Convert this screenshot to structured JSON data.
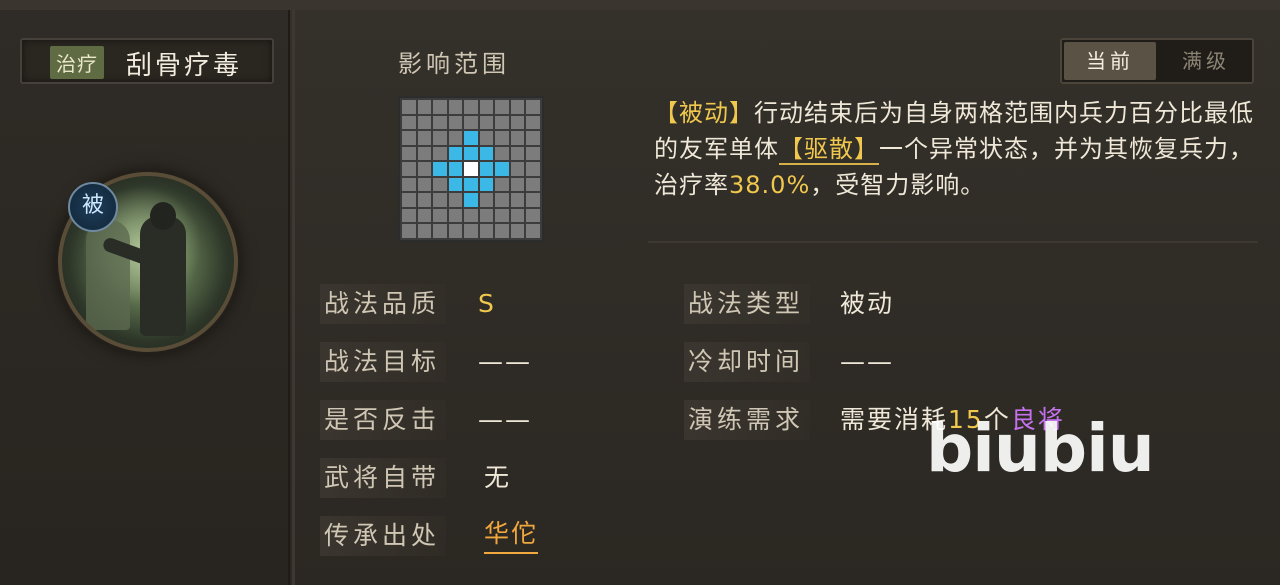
{
  "skill": {
    "type_tag": "治疗",
    "name": "刮骨疗毒",
    "passive_badge": "被"
  },
  "tabs": {
    "current": "当前",
    "max_level": "满级"
  },
  "range": {
    "label": "影响范围",
    "rows": 9,
    "cols": 9,
    "hit_cells": [
      [
        2,
        4
      ],
      [
        3,
        3
      ],
      [
        3,
        4
      ],
      [
        3,
        5
      ],
      [
        4,
        2
      ],
      [
        4,
        3
      ],
      [
        4,
        5
      ],
      [
        4,
        6
      ],
      [
        5,
        3
      ],
      [
        5,
        4
      ],
      [
        5,
        5
      ],
      [
        6,
        4
      ]
    ],
    "center_cell": [
      4,
      4
    ]
  },
  "description": {
    "tag": "【被动】",
    "text1": "行动结束后为自身两格范围内兵力百分比最低的友军单体",
    "keyword": "【驱散】",
    "text2": "一个异常状态，并为其恢复兵力，治疗率",
    "rate": "38.0%",
    "text3": "，受智力影响。"
  },
  "attributes": {
    "quality_label": "战法品质",
    "quality_value": "S",
    "type_label": "战法类型",
    "type_value": "被动",
    "target_label": "战法目标",
    "target_value": "——",
    "cooldown_label": "冷却时间",
    "cooldown_value": "——",
    "counter_label": "是否反击",
    "counter_value": "——",
    "practice_label": "演练需求",
    "practice_prefix": "需要消耗",
    "practice_count": "15",
    "practice_unit": "个",
    "practice_item": "良将",
    "innate_label": "武将自带",
    "innate_value": "无",
    "source_label": "传承出处",
    "source_value": "华佗"
  },
  "watermark": "biubiu",
  "colors": {
    "hit_cell": "#3cb8e6",
    "center_cell": "#ffffff",
    "highlight_yellow": "#f0c84e",
    "source_orange": "#f0a73e",
    "item_purple": "#c672ee"
  }
}
